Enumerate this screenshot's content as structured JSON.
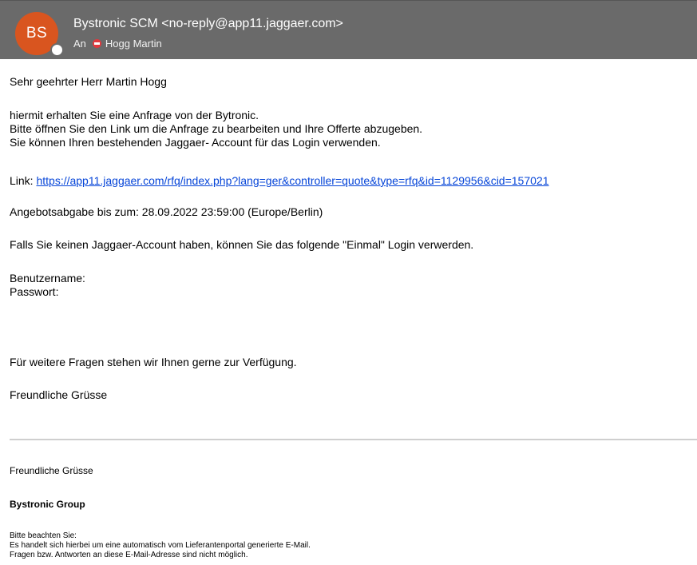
{
  "header": {
    "avatar_initials": "BS",
    "from": "Bystronic SCM <no-reply@app11.jaggaer.com>",
    "to_label": "An",
    "to_name": "Hogg Martin"
  },
  "message": {
    "salutation": "Sehr geehrter Herr Martin Hogg",
    "intro_lines": [
      "hiermit erhalten Sie eine Anfrage von der Bytronic.",
      "Bitte öffnen Sie den Link um die Anfrage zu bearbeiten und Ihre Offerte abzugeben.",
      "Sie können Ihren bestehenden Jaggaer- Account für das Login verwenden."
    ],
    "link_label": "Link:",
    "link_url": "https://app11.jaggaer.com/rfq/index.php?lang=ger&controller=quote&type=rfq&id=1129956&cid=157021",
    "deadline": "Angebotsabgabe bis zum: 28.09.2022 23:59:00 (Europe/Berlin)",
    "no_account": "Falls Sie keinen Jaggaer-Account haben, können Sie das folgende \"Einmal\" Login verwerden.",
    "username_label": "Benutzername:",
    "password_label": "Passwort:",
    "questions": "Für weitere Fragen stehen wir Ihnen gerne zur Verfügung.",
    "closing": "Freundliche Grüsse"
  },
  "signature": {
    "closing": "Freundliche Grüsse",
    "company": "Bystronic Group",
    "note_lines": [
      "Bitte beachten Sie:",
      "Es handelt sich hierbei um eine automatisch vom Lieferantenportal generierte E-Mail.",
      "Fragen bzw. Antworten an diese E-Mail-Adresse sind nicht möglich."
    ]
  },
  "colors": {
    "header_bg": "#6a6a6a",
    "avatar_bg": "#d9551f",
    "link": "#0645d8",
    "blocked_status": "#e0393e"
  }
}
